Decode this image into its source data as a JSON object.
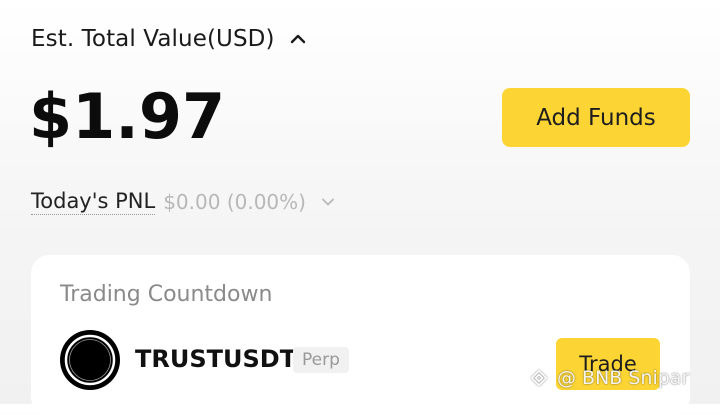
{
  "header": {
    "est_label": "Est. Total Value(USD)",
    "chevron_icon": "chevron-up-icon"
  },
  "balance": {
    "value": "$1.97"
  },
  "actions": {
    "add_funds_label": "Add Funds"
  },
  "pnl": {
    "label": "Today's PNL",
    "value": "$0.00 (0.00%)",
    "chevron_icon": "chevron-down-icon"
  },
  "card": {
    "title": "Trading Countdown",
    "item": {
      "symbol": "TRUSTUSDT",
      "badge": "Perp",
      "action_label": "Trade",
      "icon": "token-logo-icon"
    }
  },
  "watermark": {
    "text": "@ BNB Snipar"
  },
  "colors": {
    "accent": "#fcd535",
    "text_primary": "#111111",
    "text_muted": "#8a8a8a",
    "pnl_muted": "#b8b8b8"
  }
}
